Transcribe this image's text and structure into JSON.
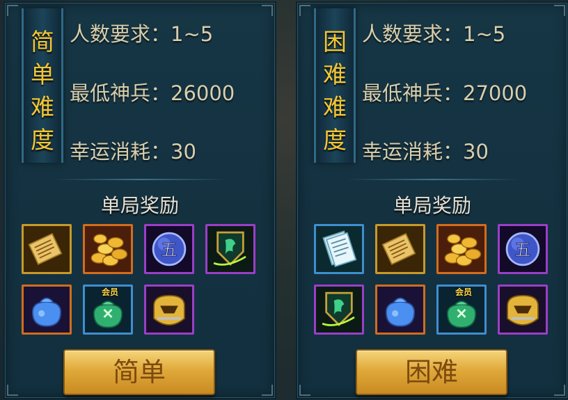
{
  "panels": [
    {
      "title_chars": [
        "简",
        "单",
        "难",
        "度"
      ],
      "player_req": "人数要求：1~5",
      "min_power": "最低神兵：26000",
      "luck_cost": "幸运消耗：30",
      "reward_title": "单局奖励",
      "rewards": [
        {
          "icon": "scroll-icon"
        },
        {
          "icon": "gold-coins-icon"
        },
        {
          "icon": "spirit-orb-five-icon"
        },
        {
          "icon": "dragon-crest-icon"
        },
        {
          "icon": "blue-bag-icon"
        },
        {
          "icon": "green-gift-bag-icon",
          "badge": "会员"
        },
        {
          "icon": "golden-helmet-icon"
        }
      ],
      "button_label": "简单"
    },
    {
      "title_chars": [
        "困",
        "难",
        "难",
        "度"
      ],
      "player_req": "人数要求：1~5",
      "min_power": "最低神兵：27000",
      "luck_cost": "幸运消耗：30",
      "reward_title": "单局奖励",
      "rewards": [
        {
          "icon": "paper-sheets-icon"
        },
        {
          "icon": "scroll-icon"
        },
        {
          "icon": "gold-coins-icon"
        },
        {
          "icon": "spirit-orb-five-icon"
        },
        {
          "icon": "dragon-crest-icon"
        },
        {
          "icon": "blue-bag-icon"
        },
        {
          "icon": "green-gift-bag-icon",
          "badge": "会员"
        },
        {
          "icon": "golden-helmet-icon"
        }
      ],
      "button_label": "困难"
    }
  ],
  "orb_char": "五",
  "colors": {
    "title_gold": "#f2c636",
    "info_text": "#d8cfae",
    "button_gold": "#e0a93a",
    "panel_bg": "#163645"
  }
}
